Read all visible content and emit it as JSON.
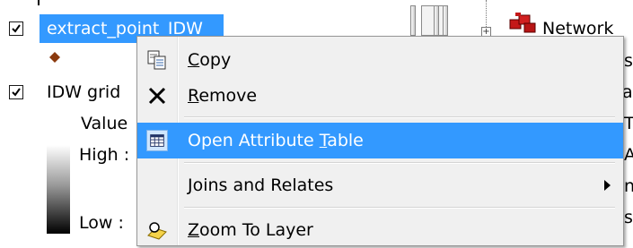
{
  "toc": {
    "layer1": {
      "name": "extract_point_IDW",
      "checked": true,
      "selected": true
    },
    "layer2": {
      "name": "IDW grid",
      "checked": true
    },
    "legend": {
      "field": "Value",
      "high": "High :",
      "low": "Low : "
    }
  },
  "background": {
    "network_label": "Network",
    "edge_letters": [
      "s",
      "at",
      "T",
      "A",
      "n",
      "s"
    ]
  },
  "context_menu": {
    "items": [
      {
        "id": "copy",
        "pre": "",
        "key": "C",
        "post": "opy",
        "icon": "copy-icon"
      },
      {
        "id": "remove",
        "pre": "",
        "key": "R",
        "post": "emove",
        "icon": "remove-x-icon"
      },
      {
        "id": "open-attribute-table",
        "pre": "Open Attribute ",
        "key": "T",
        "post": "able",
        "icon": "attribute-table-icon",
        "highlighted": true
      },
      {
        "id": "joins-and-relates",
        "pre": "",
        "key": "J",
        "post": "oins and Relates",
        "icon": "",
        "has_submenu": true
      },
      {
        "id": "zoom-to-layer",
        "pre": "",
        "key": "Z",
        "post": "oom To Layer",
        "icon": "zoom-to-layer-icon"
      }
    ]
  },
  "colors": {
    "selection": "#3399ff",
    "menu_bg": "#f0f0f0",
    "symbol": "#8b3a0e"
  }
}
